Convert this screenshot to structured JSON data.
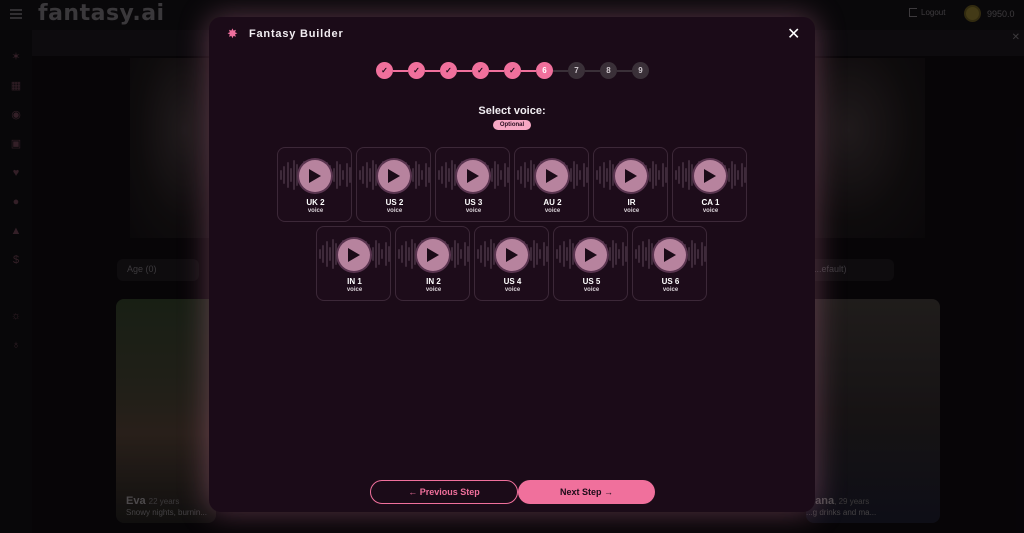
{
  "app": {
    "logo": "fantasy.ai",
    "logout_label": "Logout",
    "coins": "9950.0"
  },
  "background": {
    "filter_left": "Age (0)",
    "filter_right": "...efault)",
    "card_left": {
      "name": "Eva",
      "age": "22 years",
      "desc": "Snowy nights, burnin..."
    },
    "card_right": {
      "name": "...ana",
      "age": ", 29 years",
      "desc": "...g drinks and ma..."
    }
  },
  "modal": {
    "title": "Fantasy Builder",
    "close_icon": "close-icon",
    "heading": "Select voice:",
    "optional_badge": "Optional",
    "steps": [
      {
        "label": "✓",
        "state": "done"
      },
      {
        "label": "✓",
        "state": "done"
      },
      {
        "label": "✓",
        "state": "done"
      },
      {
        "label": "✓",
        "state": "done"
      },
      {
        "label": "✓",
        "state": "done"
      },
      {
        "label": "6",
        "state": "active"
      },
      {
        "label": "7",
        "state": "pending"
      },
      {
        "label": "8",
        "state": "pending"
      },
      {
        "label": "9",
        "state": "pending"
      }
    ],
    "voices": [
      {
        "name": "UK 2",
        "sub": "voice"
      },
      {
        "name": "US 2",
        "sub": "voice"
      },
      {
        "name": "US 3",
        "sub": "voice"
      },
      {
        "name": "AU 2",
        "sub": "voice"
      },
      {
        "name": "IR",
        "sub": "voice"
      },
      {
        "name": "CA 1",
        "sub": "voice"
      },
      {
        "name": "IN 1",
        "sub": "voice"
      },
      {
        "name": "IN 2",
        "sub": "voice"
      },
      {
        "name": "US 4",
        "sub": "voice"
      },
      {
        "name": "US 5",
        "sub": "voice"
      },
      {
        "name": "US 6",
        "sub": "voice"
      }
    ],
    "prev_label": "←  Previous Step",
    "next_label": "Next Step  →"
  },
  "colors": {
    "accent": "#f0709c",
    "modal_bg": "#1b0b18",
    "pending_step": "#3a3038"
  }
}
